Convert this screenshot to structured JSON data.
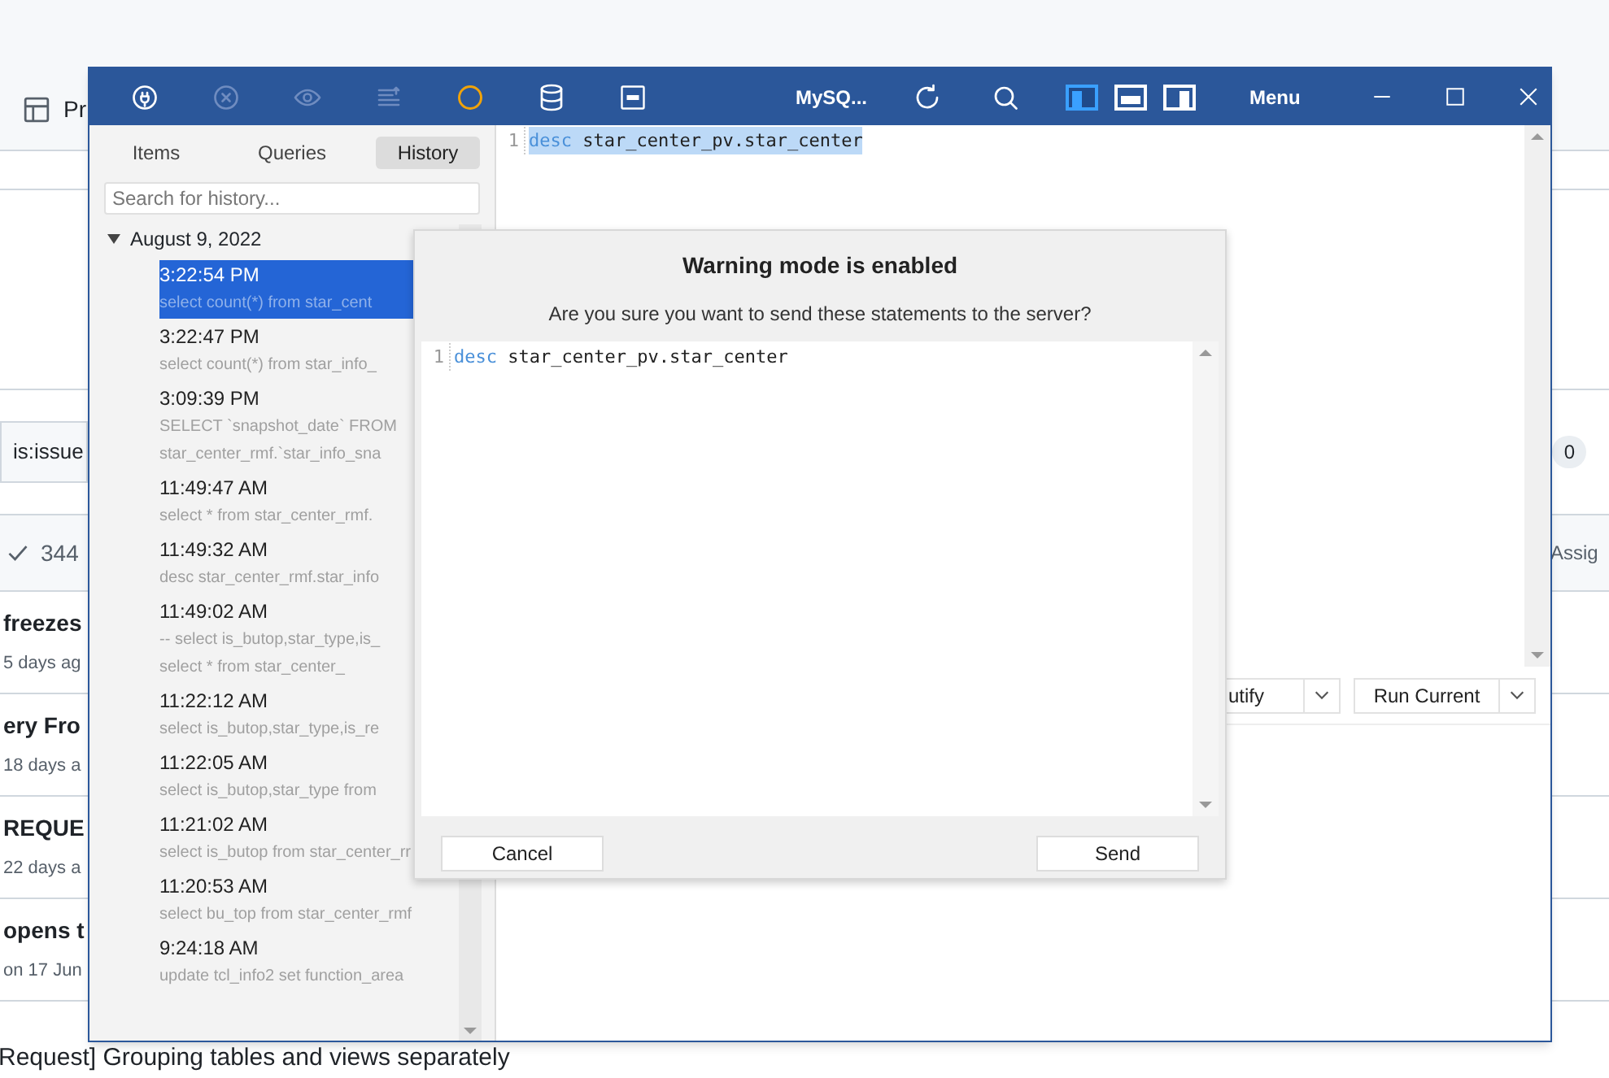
{
  "background_page": {
    "tab": {
      "label": "Pr"
    },
    "search": {
      "value": "is:issue"
    },
    "count_badge": "0",
    "header": {
      "count": "344",
      "column": "Assig"
    },
    "issues": [
      {
        "title": "freezes",
        "meta": "5 days ag"
      },
      {
        "title": "ery Fro",
        "meta": "18 days a"
      },
      {
        "title": "REQUE",
        "meta": "22 days a"
      },
      {
        "title": "opens t",
        "meta": "on 17 Jun"
      }
    ],
    "last_issue": "Request] Grouping tables and views separately"
  },
  "app_window": {
    "toolbar": [
      {
        "kind": "plug",
        "disabled": false
      },
      {
        "kind": "stop",
        "disabled": true
      },
      {
        "kind": "eye",
        "disabled": true
      },
      {
        "kind": "list",
        "disabled": true
      },
      {
        "kind": "status",
        "disabled": false
      },
      {
        "kind": "database",
        "disabled": false
      },
      {
        "kind": "sql",
        "disabled": false
      }
    ],
    "title": "MySQ...",
    "actions": [
      {
        "kind": "refresh"
      },
      {
        "kind": "search"
      }
    ],
    "view_buttons": [
      {
        "kind": "left",
        "selected": true
      },
      {
        "kind": "bottom",
        "selected": false
      },
      {
        "kind": "right",
        "selected": false
      }
    ],
    "menu": "Menu",
    "sidebar": {
      "tabs": [
        {
          "label": "Items",
          "selected": false
        },
        {
          "label": "Queries",
          "selected": false
        },
        {
          "label": "History",
          "selected": true
        }
      ],
      "search": {
        "placeholder": "Search for history..."
      },
      "tree": [
        {
          "label": "August 9, 2022",
          "expanded": true,
          "children": [
            {
              "time": "3:22:54 PM",
              "lines": [
                "select count(*) from star_cent"
              ],
              "selected": true
            },
            {
              "time": "3:22:47 PM",
              "lines": [
                "select count(*) from star_info_"
              ],
              "selected": false
            },
            {
              "time": "3:09:39 PM",
              "lines": [
                "SELECT `snapshot_date` FROM",
                "star_center_rmf.`star_info_sna"
              ],
              "selected": false
            },
            {
              "time": "11:49:47 AM",
              "lines": [
                "select * from star_center_rmf."
              ],
              "selected": false
            },
            {
              "time": "11:49:32 AM",
              "lines": [
                "desc star_center_rmf.star_info"
              ],
              "selected": false
            },
            {
              "time": "11:49:02 AM",
              "lines": [
                "-- select is_butop,star_type,is_",
                "select * from star_center_"
              ],
              "selected": false
            },
            {
              "time": "11:22:12 AM",
              "lines": [
                "select is_butop,star_type,is_re"
              ],
              "selected": false
            },
            {
              "time": "11:22:05 AM",
              "lines": [
                "select is_butop,star_type from"
              ],
              "selected": false
            },
            {
              "time": "11:21:02 AM",
              "lines": [
                "select is_butop from star_center_rr"
              ],
              "selected": false
            },
            {
              "time": "11:20:53 AM",
              "lines": [
                "select bu_top from star_center_rmf"
              ],
              "selected": false
            },
            {
              "time": "9:24:18 AM",
              "lines": [
                "update tcl_info2 set function_area"
              ],
              "selected": false
            }
          ]
        }
      ]
    },
    "editor": {
      "lines": [
        {
          "number": "1",
          "keyword": "desc",
          "text": "star_center_pv.star_center",
          "highlighted": true
        }
      ]
    },
    "buttons": [
      {
        "label": "utify"
      },
      {
        "label": "Run Current"
      }
    ]
  },
  "dialog": {
    "title": "Warning mode is enabled",
    "message": "Are you sure you want to send these statements to the server?",
    "code": [
      {
        "number": "1",
        "keyword": "desc",
        "text": "star_center_pv.star_center",
        "highlighted": false
      }
    ],
    "buttons": [
      {
        "label": "Cancel"
      },
      {
        "label": "Send"
      }
    ]
  }
}
